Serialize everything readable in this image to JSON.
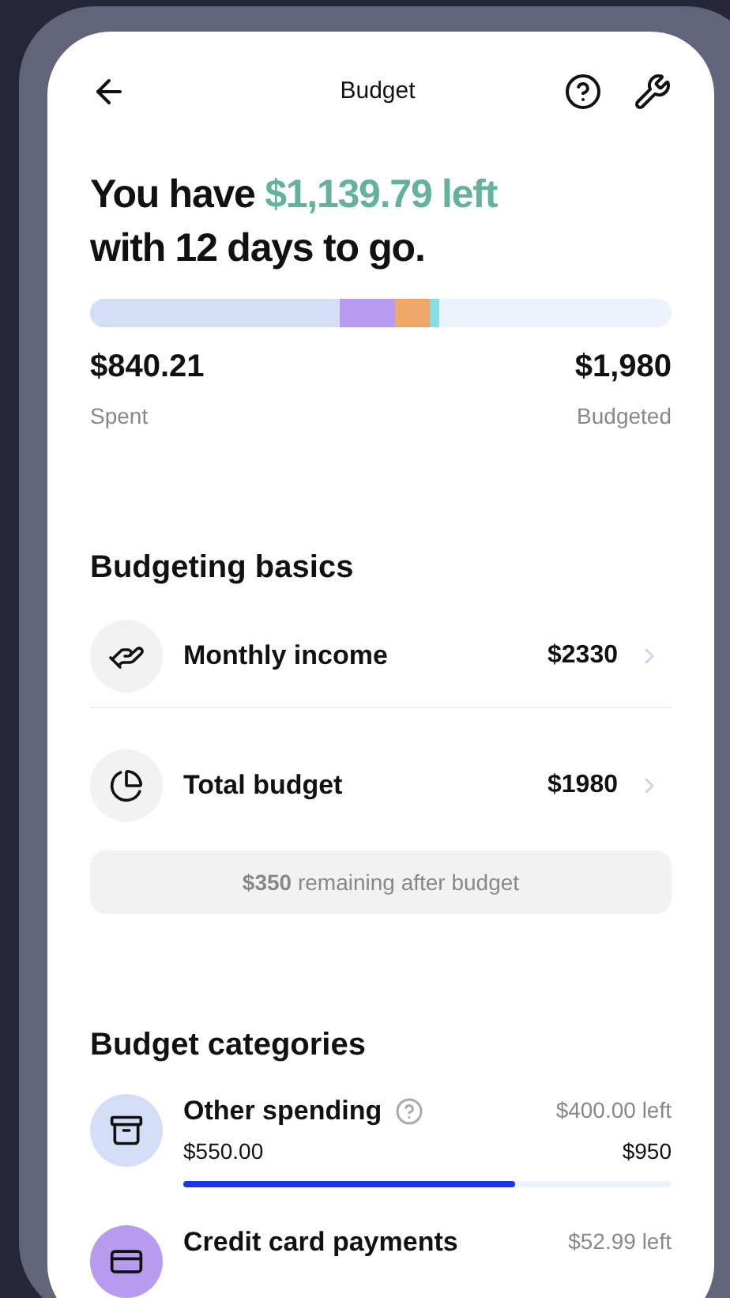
{
  "header": {
    "title": "Budget"
  },
  "summary": {
    "headline_start": "You have",
    "headline_amount": "$1,139.79 left",
    "headline_end": "with 12 days to go.",
    "segments": [
      {
        "color": "#d5def7"
      },
      {
        "color": "#b69bef"
      },
      {
        "color": "#f0a868"
      },
      {
        "color": "#86dfe6"
      }
    ],
    "spent": "$840.21",
    "spent_label": "Spent",
    "budgeted": "$1,980",
    "budgeted_label": "Budgeted"
  },
  "basics": {
    "title": "Budgeting basics",
    "items": [
      {
        "kind": "income",
        "label": "Monthly income",
        "value": "$2330"
      },
      {
        "kind": "budget",
        "label": "Total budget",
        "value": "$1980"
      }
    ],
    "note_amount": "$350",
    "note_text": "remaining after budget"
  },
  "categories": {
    "title": "Budget categories",
    "items": [
      {
        "kind": "other",
        "name": "Other spending",
        "help": true,
        "left": "$400.00 left",
        "spent": "$550.00",
        "budget": "$950",
        "color": "#d5def7",
        "level": 0.68
      },
      {
        "kind": "card",
        "name": "Credit card payments",
        "help": false,
        "left": "$52.99 left",
        "color": "#b69bef"
      }
    ]
  }
}
